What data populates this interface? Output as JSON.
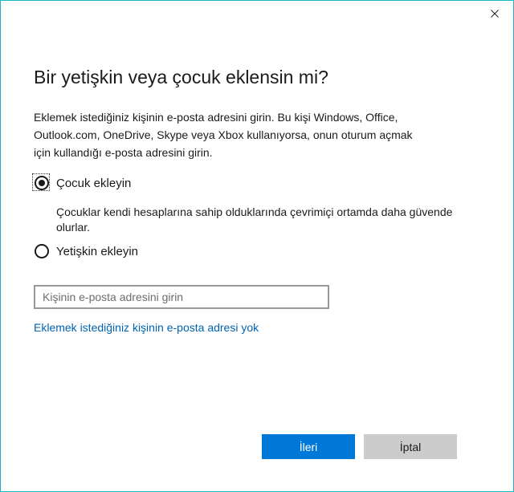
{
  "dialog": {
    "heading": "Bir yetişkin veya çocuk eklensin mi?",
    "description": "Eklemek istediğiniz kişinin e-posta adresini girin. Bu kişi Windows, Office, Outlook.com, OneDrive, Skype veya Xbox kullanıyorsa, onun oturum açmak için kullandığı e-posta adresini girin.",
    "options": {
      "child_label": "Çocuk ekleyin",
      "child_selected": true,
      "child_note": "Çocuklar kendi hesaplarına sahip olduklarında çevrimiçi ortamda daha güvende olurlar.",
      "adult_label": "Yetişkin ekleyin",
      "adult_selected": false
    },
    "email": {
      "value": "",
      "placeholder": "Kişinin e-posta adresini girin"
    },
    "no_email_link": "Eklemek istediğiniz kişinin e-posta adresi yok",
    "buttons": {
      "next_label": "İleri",
      "cancel_label": "İptal"
    }
  },
  "icons": {
    "close": "close-icon"
  },
  "colors": {
    "accent": "#0078d7",
    "link": "#0063b1",
    "window_border": "#18b4c8",
    "cancel_bg": "#cccccc"
  }
}
